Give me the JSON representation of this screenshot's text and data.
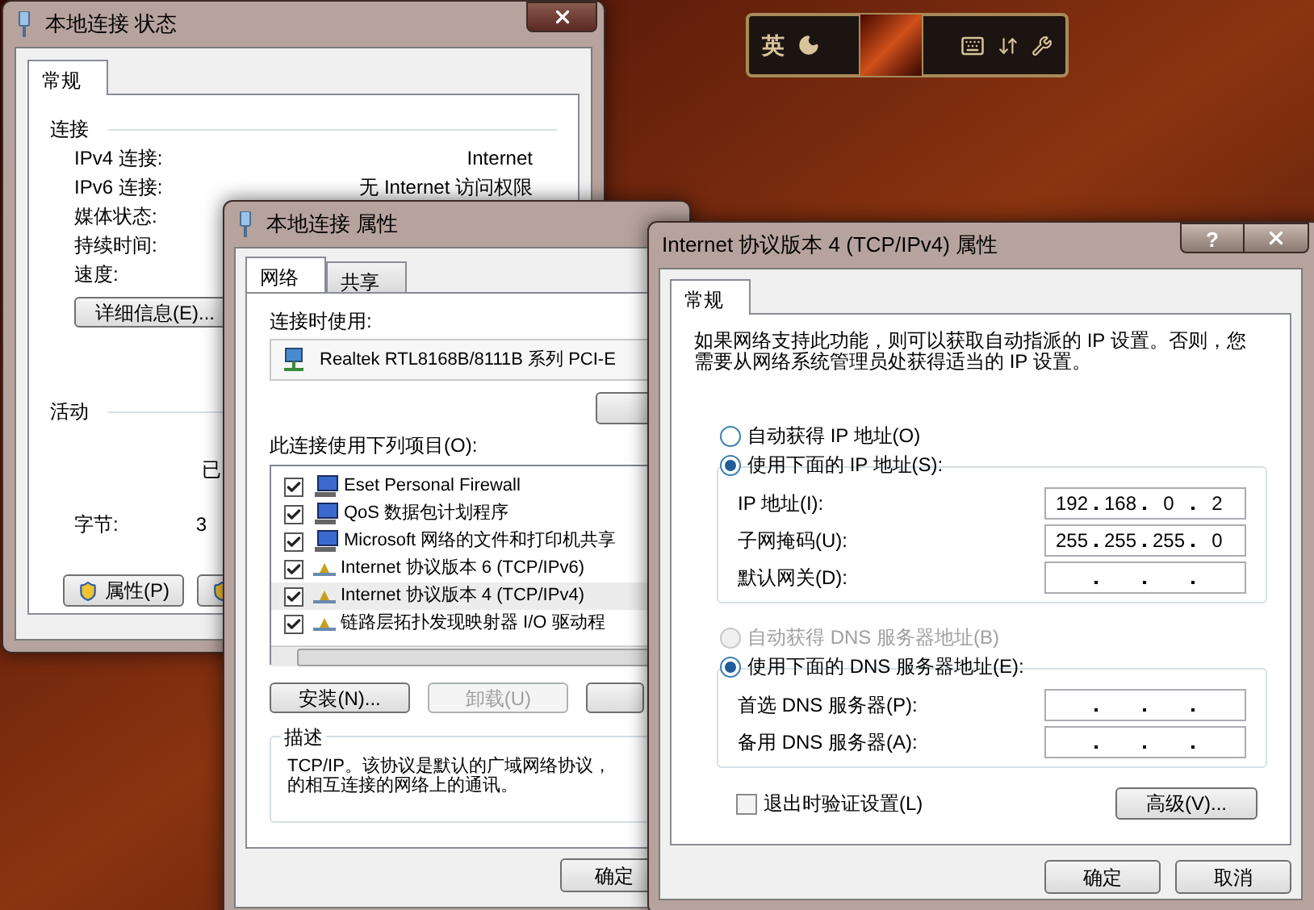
{
  "ime_toolbar": {
    "mode_label": "英"
  },
  "status_window": {
    "title": "本地连接 状态",
    "tabs": [
      {
        "label": "常规",
        "selected": true
      }
    ],
    "connection": {
      "heading": "连接",
      "rows": [
        {
          "label": "IPv4 连接:",
          "value": "Internet"
        },
        {
          "label": "IPv6 连接:",
          "value": "无 Internet 访问权限"
        },
        {
          "label": "媒体状态:"
        },
        {
          "label": "持续时间:"
        },
        {
          "label": "速度:"
        }
      ]
    },
    "details_button": "详细信息(E)...",
    "activity": {
      "heading": "活动",
      "sent_label": "已",
      "bytes_label": "字节:",
      "bytes_value": "3"
    },
    "properties_button": "属性(P)"
  },
  "properties_window": {
    "title": "本地连接 属性",
    "tabs": [
      {
        "label": "网络",
        "selected": true
      },
      {
        "label": "共享",
        "selected": false
      }
    ],
    "connect_using_label": "连接时使用:",
    "adapter": "Realtek RTL8168B/8111B 系列 PCI-E",
    "items_label": "此连接使用下列项目(O):",
    "items": [
      {
        "label": "Eset Personal Firewall",
        "kind": "service",
        "checked": true,
        "selected": false
      },
      {
        "label": "QoS 数据包计划程序",
        "kind": "service",
        "checked": true,
        "selected": false
      },
      {
        "label": "Microsoft 网络的文件和打印机共享",
        "kind": "service",
        "checked": true,
        "selected": false
      },
      {
        "label": "Internet 协议版本 6 (TCP/IPv6)",
        "kind": "protocol",
        "checked": true,
        "selected": false
      },
      {
        "label": "Internet 协议版本 4 (TCP/IPv4)",
        "kind": "protocol",
        "checked": true,
        "selected": true
      },
      {
        "label": "链路层拓扑发现映射器 I/O 驱动程",
        "kind": "protocol",
        "checked": true,
        "selected": false
      }
    ],
    "buttons": [
      {
        "label": "安装(N)...",
        "disabled": false
      },
      {
        "label": "卸载(U)",
        "disabled": true
      }
    ],
    "description": {
      "heading": "描述",
      "lines": [
        "TCP/IP。该协议是默认的广域网络协议，",
        "的相互连接的网络上的通讯。"
      ]
    },
    "ok_button": "确定"
  },
  "ipv4_window": {
    "title": "Internet 协议版本 4 (TCP/IPv4) 属性",
    "help_button": "?",
    "tabs": [
      {
        "label": "常规",
        "selected": true
      }
    ],
    "intro": "如果网络支持此功能，则可以获取自动指派的 IP 设置。否则，您需要从网络系统管理员处获得适当的 IP 设置。",
    "ip_modes": [
      {
        "label": "自动获得 IP 地址(O)",
        "selected": false,
        "disabled": false
      },
      {
        "label": "使用下面的 IP 地址(S):",
        "selected": true,
        "disabled": false
      }
    ],
    "ip_fields": [
      {
        "label": "IP 地址(I):",
        "octets": [
          "192",
          "168",
          "0",
          "2"
        ]
      },
      {
        "label": "子网掩码(U):",
        "octets": [
          "255",
          "255",
          "255",
          "0"
        ]
      },
      {
        "label": "默认网关(D):"
      }
    ],
    "dns_modes": [
      {
        "label": "自动获得 DNS 服务器地址(B)",
        "selected": false,
        "disabled": true
      },
      {
        "label": "使用下面的 DNS 服务器地址(E):",
        "selected": true,
        "disabled": false
      }
    ],
    "dns_fields": [
      {
        "label": "首选 DNS 服务器(P):"
      },
      {
        "label": "备用 DNS 服务器(A):"
      }
    ],
    "validate_on_exit": {
      "label": "退出时验证设置(L)",
      "checked": false
    },
    "advanced_button": "高级(V)...",
    "buttons": [
      "确定",
      "取消"
    ]
  }
}
